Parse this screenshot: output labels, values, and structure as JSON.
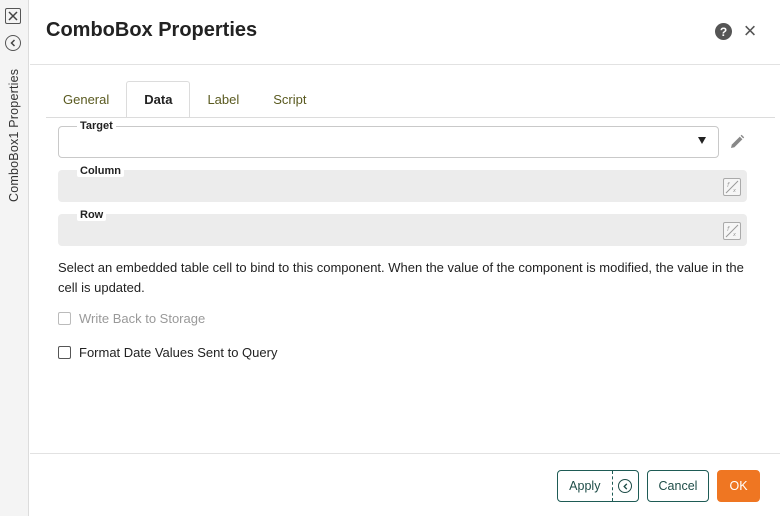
{
  "sidebar": {
    "title": "ComboBox1 Properties"
  },
  "dialog": {
    "title": "ComboBox Properties",
    "help_icon_text": "?",
    "close_icon_text": "×"
  },
  "tabs": [
    {
      "label": "General",
      "active": false
    },
    {
      "label": "Data",
      "active": true
    },
    {
      "label": "Label",
      "active": false
    },
    {
      "label": "Script",
      "active": false
    }
  ],
  "fields": {
    "target": {
      "label": "Target",
      "value": ""
    },
    "column": {
      "label": "Column",
      "value": ""
    },
    "row": {
      "label": "Row",
      "value": ""
    }
  },
  "description": "Select an embedded table cell to bind to this component. When the value of the component is modified, the value in the cell is updated.",
  "options": {
    "write_back": {
      "label": "Write Back to Storage",
      "checked": false,
      "disabled": true
    },
    "format_date": {
      "label": "Format Date Values Sent to Query",
      "checked": false,
      "disabled": false
    }
  },
  "buttons": {
    "apply": "Apply",
    "cancel": "Cancel",
    "ok": "OK"
  },
  "colors": {
    "accent": "#ef7622",
    "button_border": "#1e5b55"
  }
}
